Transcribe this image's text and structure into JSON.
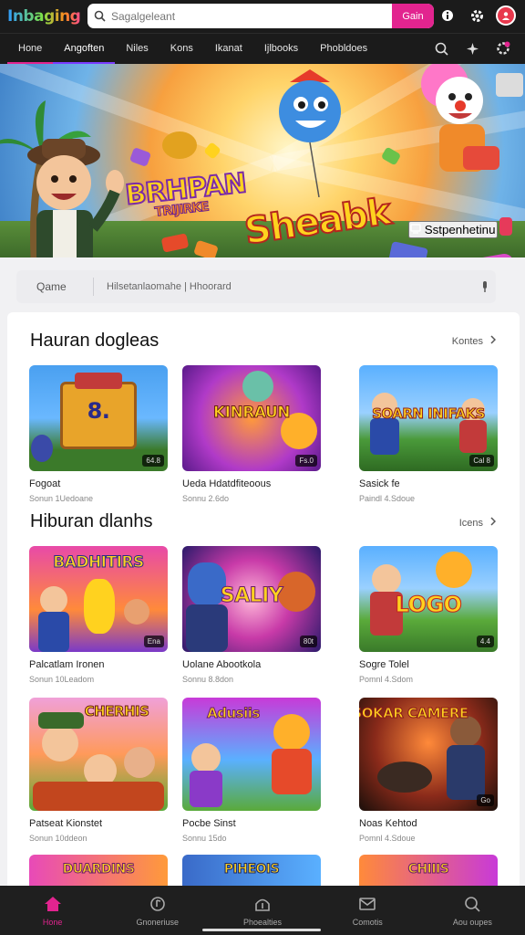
{
  "app": {
    "logo": "Inbaging",
    "search_placeholder": "Sagalgeleant",
    "search_button": "Gain"
  },
  "nav": {
    "tabs": [
      "Hone",
      "Angoften",
      "Niles",
      "Kons",
      "Ikanat",
      "Ijlbooks",
      "Phobldoes"
    ]
  },
  "hero": {
    "title_a": "BRHPAN",
    "title_a_sub": "TRIJIRKE",
    "title_b": "Sheabk",
    "cta_label": "Sstpenhetinu"
  },
  "filter": {
    "category": "Qame",
    "placeholder": "Hilsetanlaomahe | Hhoorard"
  },
  "sections": [
    {
      "title": "Hauran dogleas",
      "more": "Kontes",
      "cards": [
        {
          "name": "Fogoat",
          "meta": "Sonun 1Uedoane",
          "badge": "64.8",
          "thumb_text": "8."
        },
        {
          "name": "Ueda Hdatdfiteoous",
          "meta": "Sonnu 2.6do",
          "badge": "Fs.0",
          "thumb_text": "KINRAUN"
        },
        {
          "name": "Sasick fe",
          "meta": "Paindl 4.Sdoue",
          "badge": "Cal 8",
          "thumb_text": "SOARN INIFAKS"
        }
      ]
    },
    {
      "title": "Hiburan dlanhs",
      "more": "Icens",
      "cards": [
        {
          "name": "Palcatlam Ironen",
          "meta": "Sonun 10Leadom",
          "badge": "Ena",
          "thumb_text": "BADHITIRS"
        },
        {
          "name": "Uolane Abootkola",
          "meta": "Sonnu 8.8don",
          "badge": "80t",
          "thumb_text": "SALIY"
        },
        {
          "name": "Sogre Tolel",
          "meta": "Pomnl 4.Sdom",
          "badge": "4.4",
          "thumb_text": "LOGO"
        }
      ]
    },
    {
      "title": "",
      "more": "",
      "cards": [
        {
          "name": "Patseat Kionstet",
          "meta": "Sonun 10ddeon",
          "badge": "",
          "thumb_text": "CHERHIS"
        },
        {
          "name": "Pocbe Sinst",
          "meta": "Sonnu 15do",
          "badge": "",
          "thumb_text": "Adusiis"
        },
        {
          "name": "Noas Kehtod",
          "meta": "Pomnl 4.Sdoue",
          "badge": "Go",
          "thumb_text": "SOKAR CAMERE"
        }
      ]
    },
    {
      "title": "",
      "more": "",
      "cards": [
        {
          "name": "",
          "meta": "",
          "badge": "",
          "thumb_text": "DUARDINS"
        },
        {
          "name": "",
          "meta": "",
          "badge": "",
          "thumb_text": "PIHEOIS"
        },
        {
          "name": "",
          "meta": "",
          "badge": "",
          "thumb_text": "CHIIIS"
        }
      ]
    }
  ],
  "bottom_nav": [
    {
      "label": "Hone",
      "icon": "home-icon"
    },
    {
      "label": "Gnoneriuse",
      "icon": "music-note-icon"
    },
    {
      "label": "Phoealties",
      "icon": "dome-icon"
    },
    {
      "label": "Comotis",
      "icon": "mail-icon"
    },
    {
      "label": "Aou oupes",
      "icon": "search-icon"
    }
  ],
  "colors": {
    "accent": "#e2248f",
    "header_bg": "#1b1b1b",
    "secondary_tab": "#7a3cff"
  }
}
